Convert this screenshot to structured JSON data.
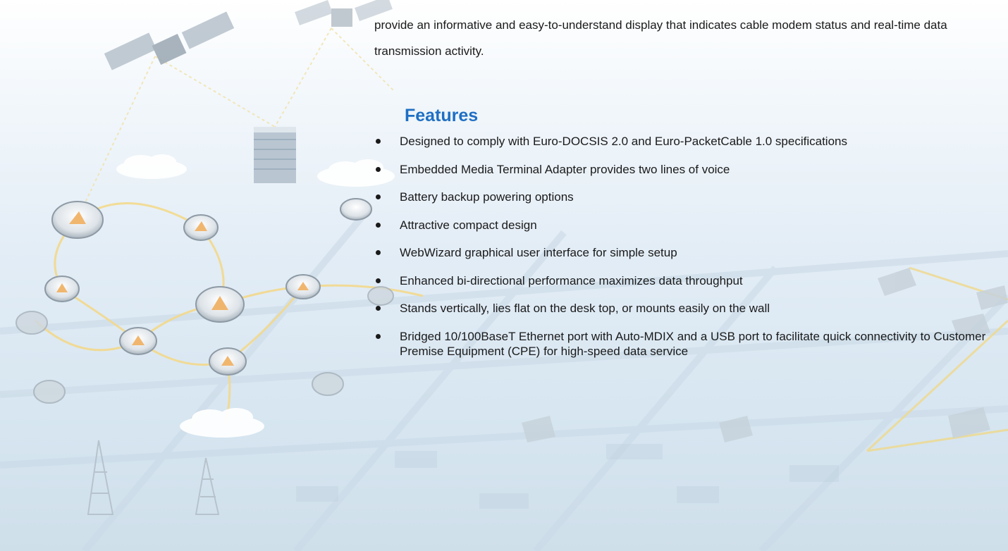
{
  "intro_paragraph": "provide an informative and easy-to-understand display that indicates cable modem status and real-time data transmission activity.",
  "features": {
    "heading": "Features",
    "items": [
      "Designed to comply with  Euro-DOCSIS 2.0 and Euro-PacketCable 1.0 specifications",
      "Embedded Media Terminal Adapter provides two lines of voice",
      "Battery backup powering options",
      "Attractive compact design",
      "WebWizard graphical user interface for simple setup",
      "Enhanced bi-directional performance maximizes data throughput",
      "Stands vertically, lies flat on the desk top, or mounts easily on the wall",
      "Bridged 10/100BaseT Ethernet port with Auto-MDIX and a USB port to facilitate quick connectivity to Customer Premise Equipment (CPE) for high-speed data service"
    ]
  },
  "colors": {
    "heading": "#1f6fc4",
    "text": "#1a1a1a",
    "background": "#dbe8f2"
  }
}
